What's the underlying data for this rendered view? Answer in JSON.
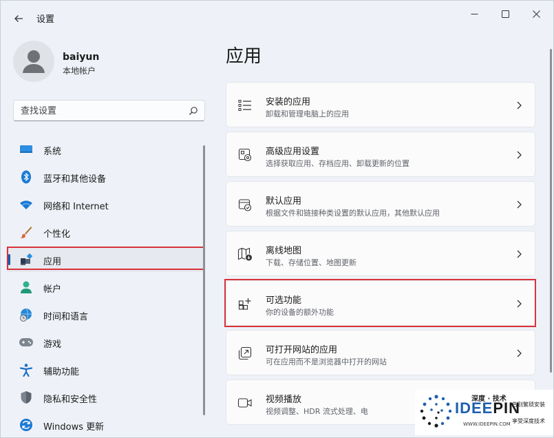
{
  "window": {
    "title": "设置"
  },
  "user": {
    "name": "baiyun",
    "account_type": "本地帐户"
  },
  "search": {
    "placeholder": "查找设置"
  },
  "sidebar": {
    "items": [
      {
        "label": "系统",
        "icon": "monitor-icon"
      },
      {
        "label": "蓝牙和其他设备",
        "icon": "bluetooth-icon"
      },
      {
        "label": "网络和 Internet",
        "icon": "wifi-icon"
      },
      {
        "label": "个性化",
        "icon": "brush-icon"
      },
      {
        "label": "应用",
        "icon": "apps-icon",
        "selected": true
      },
      {
        "label": "帐户",
        "icon": "person-icon"
      },
      {
        "label": "时间和语言",
        "icon": "globe-clock-icon"
      },
      {
        "label": "游戏",
        "icon": "gamepad-icon"
      },
      {
        "label": "辅助功能",
        "icon": "accessibility-icon"
      },
      {
        "label": "隐私和安全性",
        "icon": "shield-icon"
      },
      {
        "label": "Windows 更新",
        "icon": "update-icon"
      }
    ]
  },
  "main": {
    "title": "应用",
    "cards": [
      {
        "title": "安装的应用",
        "subtitle": "卸载和管理电脑上的应用",
        "icon": "list-icon"
      },
      {
        "title": "高级应用设置",
        "subtitle": "选择获取应用、存档应用、卸载更新的位置",
        "icon": "app-settings-icon"
      },
      {
        "title": "默认应用",
        "subtitle": "根据文件和链接种类设置的默认应用，其他默认应用",
        "icon": "default-apps-icon"
      },
      {
        "title": "离线地图",
        "subtitle": "下载、存储位置、地图更新",
        "icon": "map-icon"
      },
      {
        "title": "可选功能",
        "subtitle": "你的设备的额外功能",
        "icon": "optional-features-icon",
        "highlighted": true
      },
      {
        "title": "可打开网站的应用",
        "subtitle": "可在应用而不是浏览器中打开的网站",
        "icon": "web-apps-icon"
      },
      {
        "title": "视频播放",
        "subtitle": "视频调整、HDR 流式处理、电",
        "icon": "video-icon"
      }
    ]
  },
  "watermark": {
    "cn": "深度 · 技术",
    "brand_a": "IDEE",
    "brand_b": "PIN",
    "url": "WWW.IDEEPIN.COM",
    "line1": "告别繁琐安装",
    "line2": "享受深度技术"
  },
  "colors": {
    "accent": "#005fb8",
    "highlight": "#d9313a"
  }
}
